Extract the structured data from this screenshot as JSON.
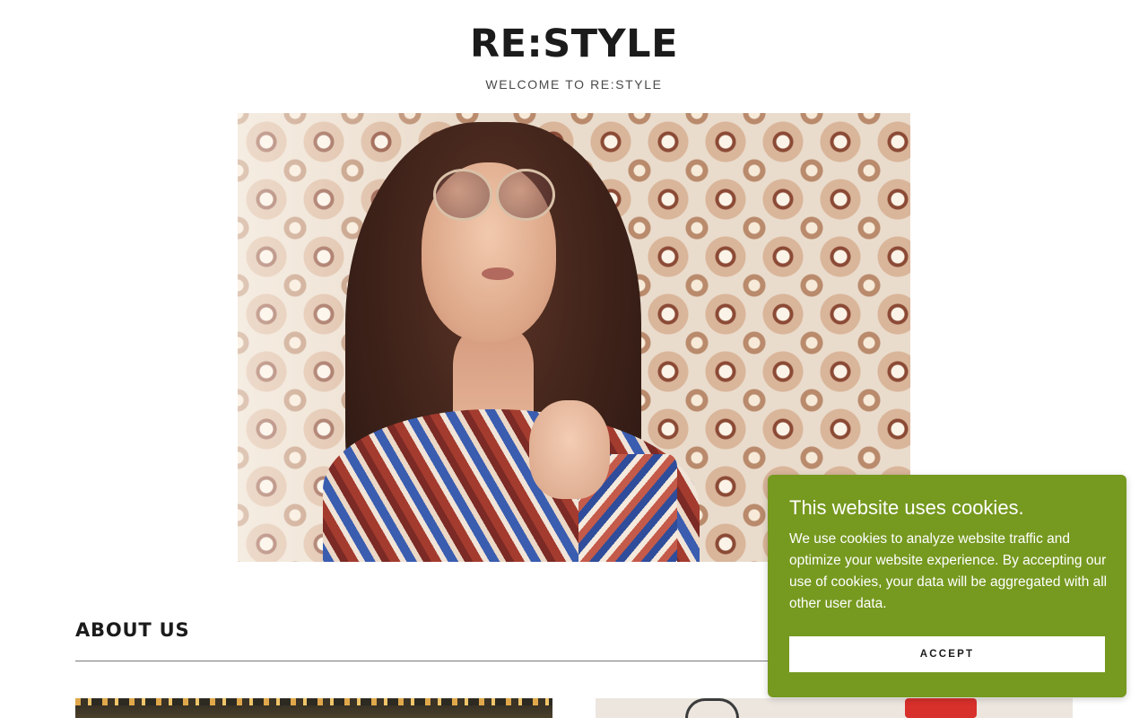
{
  "header": {
    "title": "RE:STYLE",
    "tagline": "WELCOME TO RE:STYLE"
  },
  "hero": {
    "image_description": "Woman with long brown hair wearing large round sunglasses and a patterned paisley top against retro floral wallpaper"
  },
  "about": {
    "heading": "ABOUT US"
  },
  "cookie_banner": {
    "title": "This website uses cookies.",
    "body": "We use cookies to analyze website traffic and optimize your website experience. By accepting our use of cookies, your data will be aggregated with all other user data.",
    "accept_label": "ACCEPT",
    "background_color": "#76991f"
  }
}
